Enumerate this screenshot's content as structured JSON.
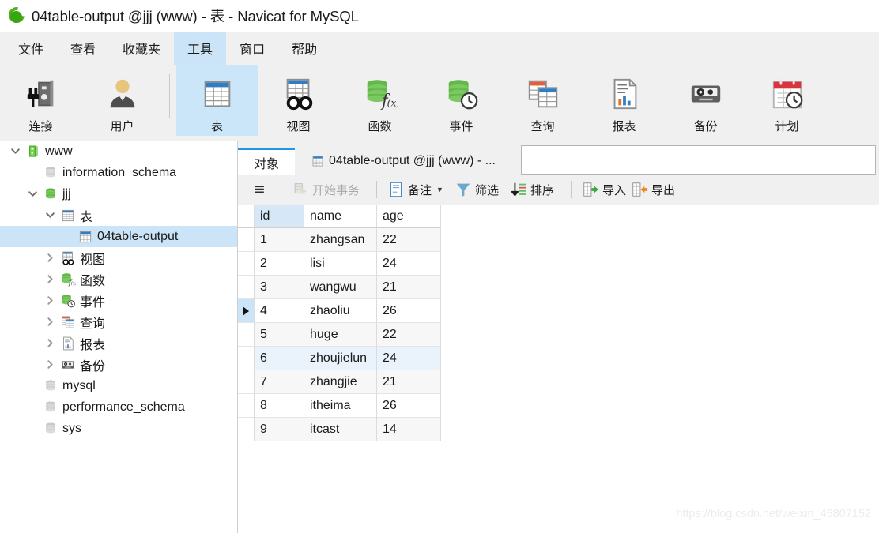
{
  "window": {
    "title": "04table-output @jjj (www) - 表 - Navicat for MySQL",
    "logo_icon": "navicat-logo-icon"
  },
  "menubar": {
    "items": [
      {
        "label": "文件",
        "name": "menu-file",
        "active": false
      },
      {
        "label": "查看",
        "name": "menu-view",
        "active": false
      },
      {
        "label": "收藏夹",
        "name": "menu-favorites",
        "active": false
      },
      {
        "label": "工具",
        "name": "menu-tools",
        "active": true
      },
      {
        "label": "窗口",
        "name": "menu-window",
        "active": false
      },
      {
        "label": "帮助",
        "name": "menu-help",
        "active": false
      }
    ]
  },
  "toolbar": {
    "items": [
      {
        "label": "连接",
        "icon": "connection-icon",
        "active": false
      },
      {
        "label": "用户",
        "icon": "user-icon",
        "active": false
      },
      {
        "label": "表",
        "icon": "table-icon",
        "active": true
      },
      {
        "label": "视图",
        "icon": "view-icon",
        "active": false
      },
      {
        "label": "函数",
        "icon": "function-icon",
        "active": false
      },
      {
        "label": "事件",
        "icon": "event-icon",
        "active": false
      },
      {
        "label": "查询",
        "icon": "query-icon",
        "active": false
      },
      {
        "label": "报表",
        "icon": "report-icon",
        "active": false
      },
      {
        "label": "备份",
        "icon": "backup-icon",
        "active": false
      },
      {
        "label": "计划",
        "icon": "schedule-icon",
        "active": false
      }
    ]
  },
  "sidebar": {
    "items": [
      {
        "label": "www",
        "icon": "server-icon",
        "indent": 0,
        "twisty": "down",
        "selected": false
      },
      {
        "label": "information_schema",
        "icon": "database-gray-icon",
        "indent": 1,
        "twisty": "none",
        "selected": false
      },
      {
        "label": "jjj",
        "icon": "database-green-icon",
        "indent": 1,
        "twisty": "down",
        "selected": false
      },
      {
        "label": "表",
        "icon": "table-icon",
        "indent": 2,
        "twisty": "down",
        "selected": false
      },
      {
        "label": "04table-output",
        "icon": "table-icon",
        "indent": 3,
        "twisty": "none",
        "selected": true
      },
      {
        "label": "视图",
        "icon": "view-icon",
        "indent": 2,
        "twisty": "right",
        "selected": false
      },
      {
        "label": "函数",
        "icon": "function-icon",
        "indent": 2,
        "twisty": "right",
        "selected": false
      },
      {
        "label": "事件",
        "icon": "event-icon",
        "indent": 2,
        "twisty": "right",
        "selected": false
      },
      {
        "label": "查询",
        "icon": "query-icon",
        "indent": 2,
        "twisty": "right",
        "selected": false
      },
      {
        "label": "报表",
        "icon": "report-icon",
        "indent": 2,
        "twisty": "right",
        "selected": false
      },
      {
        "label": "备份",
        "icon": "backup-icon",
        "indent": 2,
        "twisty": "right",
        "selected": false
      },
      {
        "label": "mysql",
        "icon": "database-gray-icon",
        "indent": 1,
        "twisty": "none",
        "selected": false
      },
      {
        "label": "performance_schema",
        "icon": "database-gray-icon",
        "indent": 1,
        "twisty": "none",
        "selected": false
      },
      {
        "label": "sys",
        "icon": "database-gray-icon",
        "indent": 1,
        "twisty": "none",
        "selected": false
      }
    ]
  },
  "tabs": [
    {
      "label": "对象",
      "name": "tab-objects",
      "icon": "none",
      "active": true
    },
    {
      "label": "04table-output @jjj (www) - ...",
      "name": "tab-table-data",
      "icon": "table-icon",
      "active": false
    }
  ],
  "datatoolbar": {
    "items": [
      {
        "label": "",
        "icon": "hamburger-icon",
        "name": "grid-menu-button",
        "disabled": false,
        "caret": false
      },
      {
        "label": "开始事务",
        "icon": "begin-transaction-icon",
        "name": "begin-transaction-button",
        "disabled": true,
        "caret": false
      },
      {
        "label": "备注",
        "icon": "note-icon",
        "name": "note-button",
        "disabled": false,
        "caret": true
      },
      {
        "label": "筛选",
        "icon": "filter-icon",
        "name": "filter-button",
        "disabled": false,
        "caret": false
      },
      {
        "label": "排序",
        "icon": "sort-icon",
        "name": "sort-button",
        "disabled": false,
        "caret": false
      },
      {
        "label": "导入",
        "icon": "import-icon",
        "name": "import-button",
        "disabled": false,
        "caret": false
      },
      {
        "label": "导出",
        "icon": "export-icon",
        "name": "export-button",
        "disabled": false,
        "caret": false
      }
    ]
  },
  "grid": {
    "columns": [
      "id",
      "name",
      "age"
    ],
    "selected_column": "id",
    "current_row_index": 4,
    "highlighted_row_index": 6,
    "rows": [
      {
        "id": "1",
        "name": "zhangsan",
        "age": "22"
      },
      {
        "id": "2",
        "name": "lisi",
        "age": "24"
      },
      {
        "id": "3",
        "name": "wangwu",
        "age": "21"
      },
      {
        "id": "4",
        "name": "zhaoliu",
        "age": "26"
      },
      {
        "id": "5",
        "name": "huge",
        "age": "22"
      },
      {
        "id": "6",
        "name": "zhoujielun",
        "age": "24"
      },
      {
        "id": "7",
        "name": "zhangjie",
        "age": "21"
      },
      {
        "id": "8",
        "name": "itheima",
        "age": "26"
      },
      {
        "id": "9",
        "name": "itcast",
        "age": "14"
      }
    ]
  },
  "watermark": "https://blog.csdn.net/weixin_45807152"
}
